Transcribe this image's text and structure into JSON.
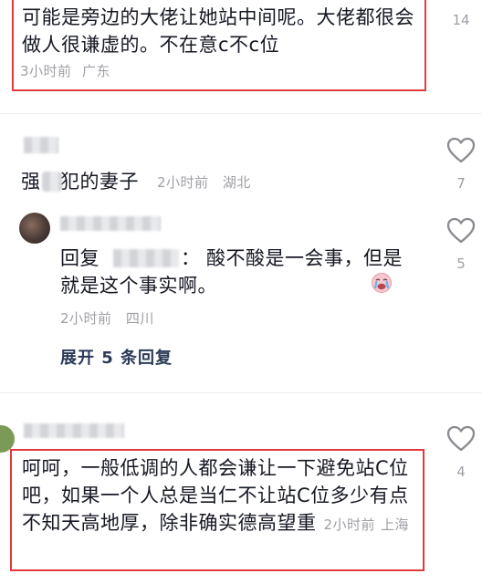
{
  "comments": [
    {
      "text": "可能是旁边的大佬让她站中间呢。大佬都很会做人很谦虚的。不在意c不c位",
      "time": "3小时前",
      "location": "广东",
      "likes": "14"
    },
    {
      "text": "强　犯的妻子",
      "time": "2小时前",
      "location": "湖北",
      "likes": "7"
    },
    {
      "reply_prefix": "回复",
      "reply_colon": "：",
      "text": "酸不酸是一会事，但是就是这个事实啊。",
      "time": "2小时前",
      "location": "四川",
      "likes": "5"
    },
    {
      "text": "呵呵，一般低调的人都会谦让一下避免站C位吧，如果一个人总是当仁不让站C位多少有点不知天高地厚，除非确实德高望重",
      "time": "2小时前",
      "location": "上海",
      "likes": "4"
    }
  ],
  "expand_replies": "展开 5 条回复",
  "colors": {
    "text": "#161823",
    "meta": "#9fa0a6",
    "highlight_border": "#e5393b"
  },
  "icons": [
    "heart-icon",
    "crying-emoji-icon"
  ]
}
